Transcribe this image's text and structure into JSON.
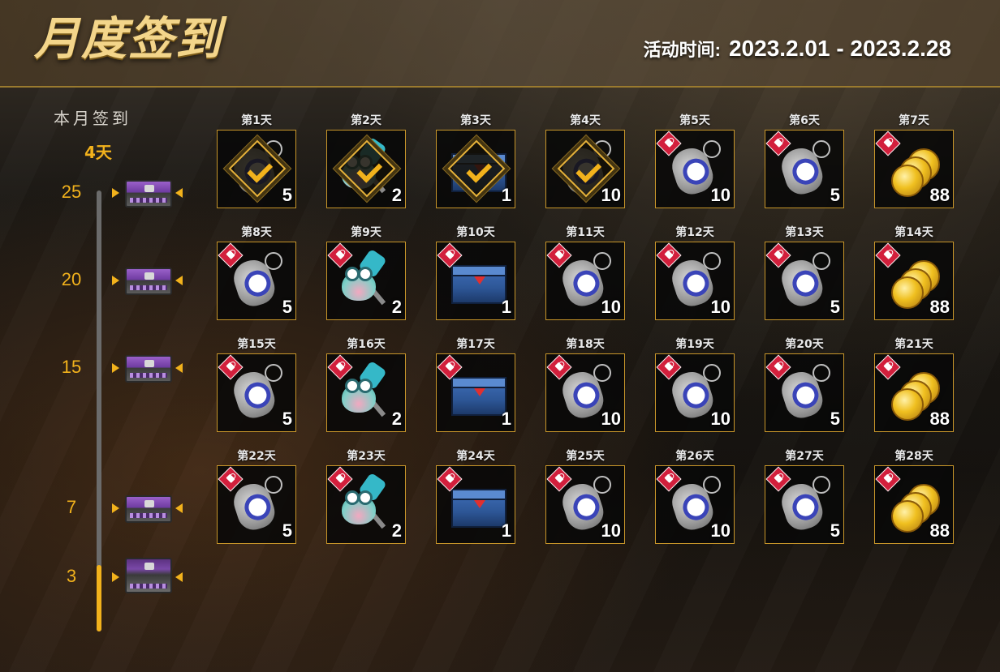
{
  "header": {
    "title": "月度签到",
    "period_label": "活动时间:",
    "period_value": "2023.2.01 - 2023.2.28"
  },
  "progress": {
    "title": "本月签到",
    "count": "4天",
    "fill_fraction": 0.15,
    "milestones": [
      {
        "days": "25",
        "chest": "purple-chest-icon"
      },
      {
        "days": "20",
        "chest": "purple-chest-icon"
      },
      {
        "days": "15",
        "chest": "purple-chest-icon"
      },
      {
        "days": "7",
        "chest": "purple-chest-icon"
      },
      {
        "days": "3",
        "chest": "open-chest-icon"
      }
    ]
  },
  "days": [
    {
      "label": "第1天",
      "item": "dogtag",
      "qty": "5",
      "claimed": true
    },
    {
      "label": "第2天",
      "item": "frog-hammer",
      "qty": "2",
      "claimed": true
    },
    {
      "label": "第3天",
      "item": "crate",
      "qty": "1",
      "claimed": true
    },
    {
      "label": "第4天",
      "item": "dogtag",
      "qty": "10",
      "claimed": true
    },
    {
      "label": "第5天",
      "item": "dogtag",
      "qty": "10",
      "claimed": false
    },
    {
      "label": "第6天",
      "item": "dogtag",
      "qty": "5",
      "claimed": false
    },
    {
      "label": "第7天",
      "item": "coins",
      "qty": "88",
      "claimed": false
    },
    {
      "label": "第8天",
      "item": "dogtag",
      "qty": "5",
      "claimed": false
    },
    {
      "label": "第9天",
      "item": "frog-hammer",
      "qty": "2",
      "claimed": false
    },
    {
      "label": "第10天",
      "item": "crate",
      "qty": "1",
      "claimed": false
    },
    {
      "label": "第11天",
      "item": "dogtag",
      "qty": "10",
      "claimed": false
    },
    {
      "label": "第12天",
      "item": "dogtag",
      "qty": "10",
      "claimed": false
    },
    {
      "label": "第13天",
      "item": "dogtag",
      "qty": "5",
      "claimed": false
    },
    {
      "label": "第14天",
      "item": "coins",
      "qty": "88",
      "claimed": false
    },
    {
      "label": "第15天",
      "item": "dogtag",
      "qty": "5",
      "claimed": false
    },
    {
      "label": "第16天",
      "item": "frog-hammer",
      "qty": "2",
      "claimed": false
    },
    {
      "label": "第17天",
      "item": "crate",
      "qty": "1",
      "claimed": false
    },
    {
      "label": "第18天",
      "item": "dogtag",
      "qty": "10",
      "claimed": false
    },
    {
      "label": "第19天",
      "item": "dogtag",
      "qty": "10",
      "claimed": false
    },
    {
      "label": "第20天",
      "item": "dogtag",
      "qty": "5",
      "claimed": false
    },
    {
      "label": "第21天",
      "item": "coins",
      "qty": "88",
      "claimed": false
    },
    {
      "label": "第22天",
      "item": "dogtag",
      "qty": "5",
      "claimed": false
    },
    {
      "label": "第23天",
      "item": "frog-hammer",
      "qty": "2",
      "claimed": false
    },
    {
      "label": "第24天",
      "item": "crate",
      "qty": "1",
      "claimed": false
    },
    {
      "label": "第25天",
      "item": "dogtag",
      "qty": "10",
      "claimed": false
    },
    {
      "label": "第26天",
      "item": "dogtag",
      "qty": "10",
      "claimed": false
    },
    {
      "label": "第27天",
      "item": "dogtag",
      "qty": "5",
      "claimed": false
    },
    {
      "label": "第28天",
      "item": "coins",
      "qty": "88",
      "claimed": false
    }
  ]
}
